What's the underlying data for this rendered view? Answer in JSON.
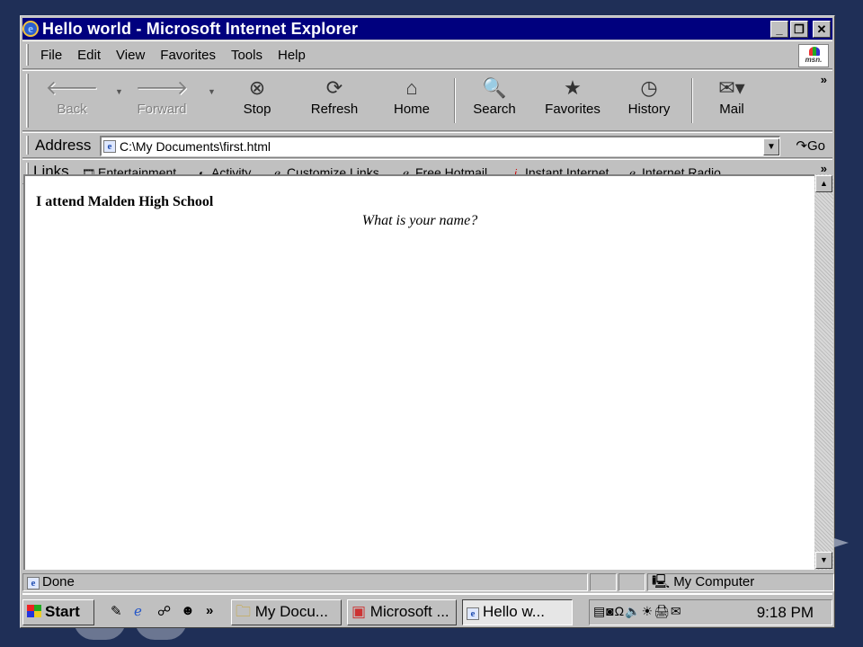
{
  "window": {
    "title": "Hello world - Microsoft Internet Explorer"
  },
  "menu": [
    "File",
    "Edit",
    "View",
    "Favorites",
    "Tools",
    "Help"
  ],
  "toolbar": {
    "back": "Back",
    "forward": "Forward",
    "stop": "Stop",
    "refresh": "Refresh",
    "home": "Home",
    "search": "Search",
    "favorites": "Favorites",
    "history": "History",
    "mail": "Mail"
  },
  "address": {
    "label": "Address",
    "value": "C:\\My Documents\\first.html",
    "go": "Go"
  },
  "links": {
    "label": "Links",
    "items": [
      "Entertainment",
      "Activity",
      "Customize Links",
      "Free Hotmail",
      "Instant Internet",
      "Internet Radio"
    ]
  },
  "page": {
    "heading": "I attend Malden High School",
    "question": "What is your name?"
  },
  "status": {
    "text": "Done",
    "zone": "My Computer"
  },
  "taskbar": {
    "start": "Start",
    "tasks": [
      "My Docu...",
      "Microsoft ...",
      "Hello w..."
    ],
    "clock": "9:18 PM"
  }
}
